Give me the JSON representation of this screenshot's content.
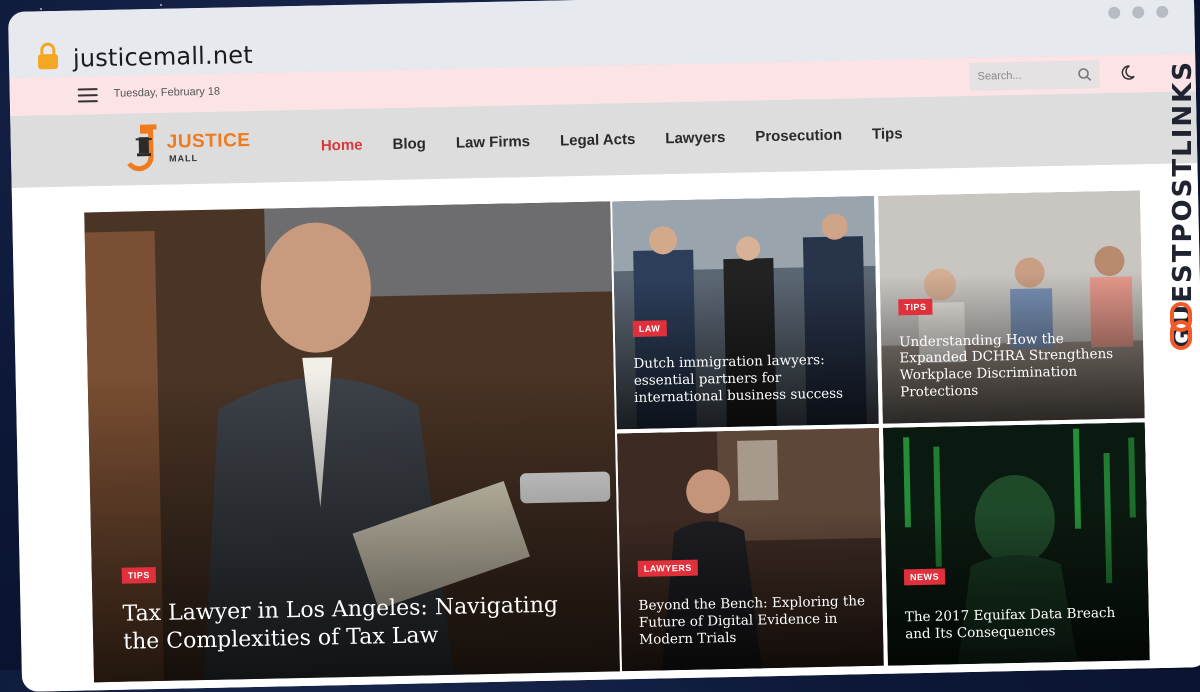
{
  "browser": {
    "url": "justicemall.net"
  },
  "topbar": {
    "date": "Tuesday, February 18",
    "search_placeholder": "Search..."
  },
  "logo": {
    "word_main": "JUSTICE",
    "word_sub": "MALL"
  },
  "nav": {
    "items": [
      {
        "label": "Home",
        "active": true
      },
      {
        "label": "Blog",
        "active": false
      },
      {
        "label": "Law Firms",
        "active": false
      },
      {
        "label": "Legal Acts",
        "active": false
      },
      {
        "label": "Lawyers",
        "active": false
      },
      {
        "label": "Prosecution",
        "active": false
      },
      {
        "label": "Tips",
        "active": false
      }
    ]
  },
  "hero": {
    "badge": "TIPS",
    "title": "Tax Lawyer in Los Angeles: Navigating the Complexities of Tax Law"
  },
  "cards": [
    {
      "badge": "LAW",
      "title": "Dutch immigration lawyers: essential partners for international business success"
    },
    {
      "badge": "TIPS",
      "title": "Understanding How the Expanded DCHRA Strengthens Workplace Discrimination Protections"
    },
    {
      "badge": "LAWYERS",
      "title": "Beyond the Bench: Exploring the Future of Digital Evidence in Modern Trials"
    },
    {
      "badge": "NEWS",
      "title": "The 2017 Equifax Data Breach and Its Consequences"
    }
  ],
  "watermark": {
    "text": "GUESTPOSTLINKS"
  },
  "colors": {
    "accent_red": "#e0303b",
    "nav_active": "#d7383b",
    "logo_orange": "#f07a1e",
    "topbar_pink": "#fbe3e6",
    "watermark_orange": "#f25a2a"
  }
}
